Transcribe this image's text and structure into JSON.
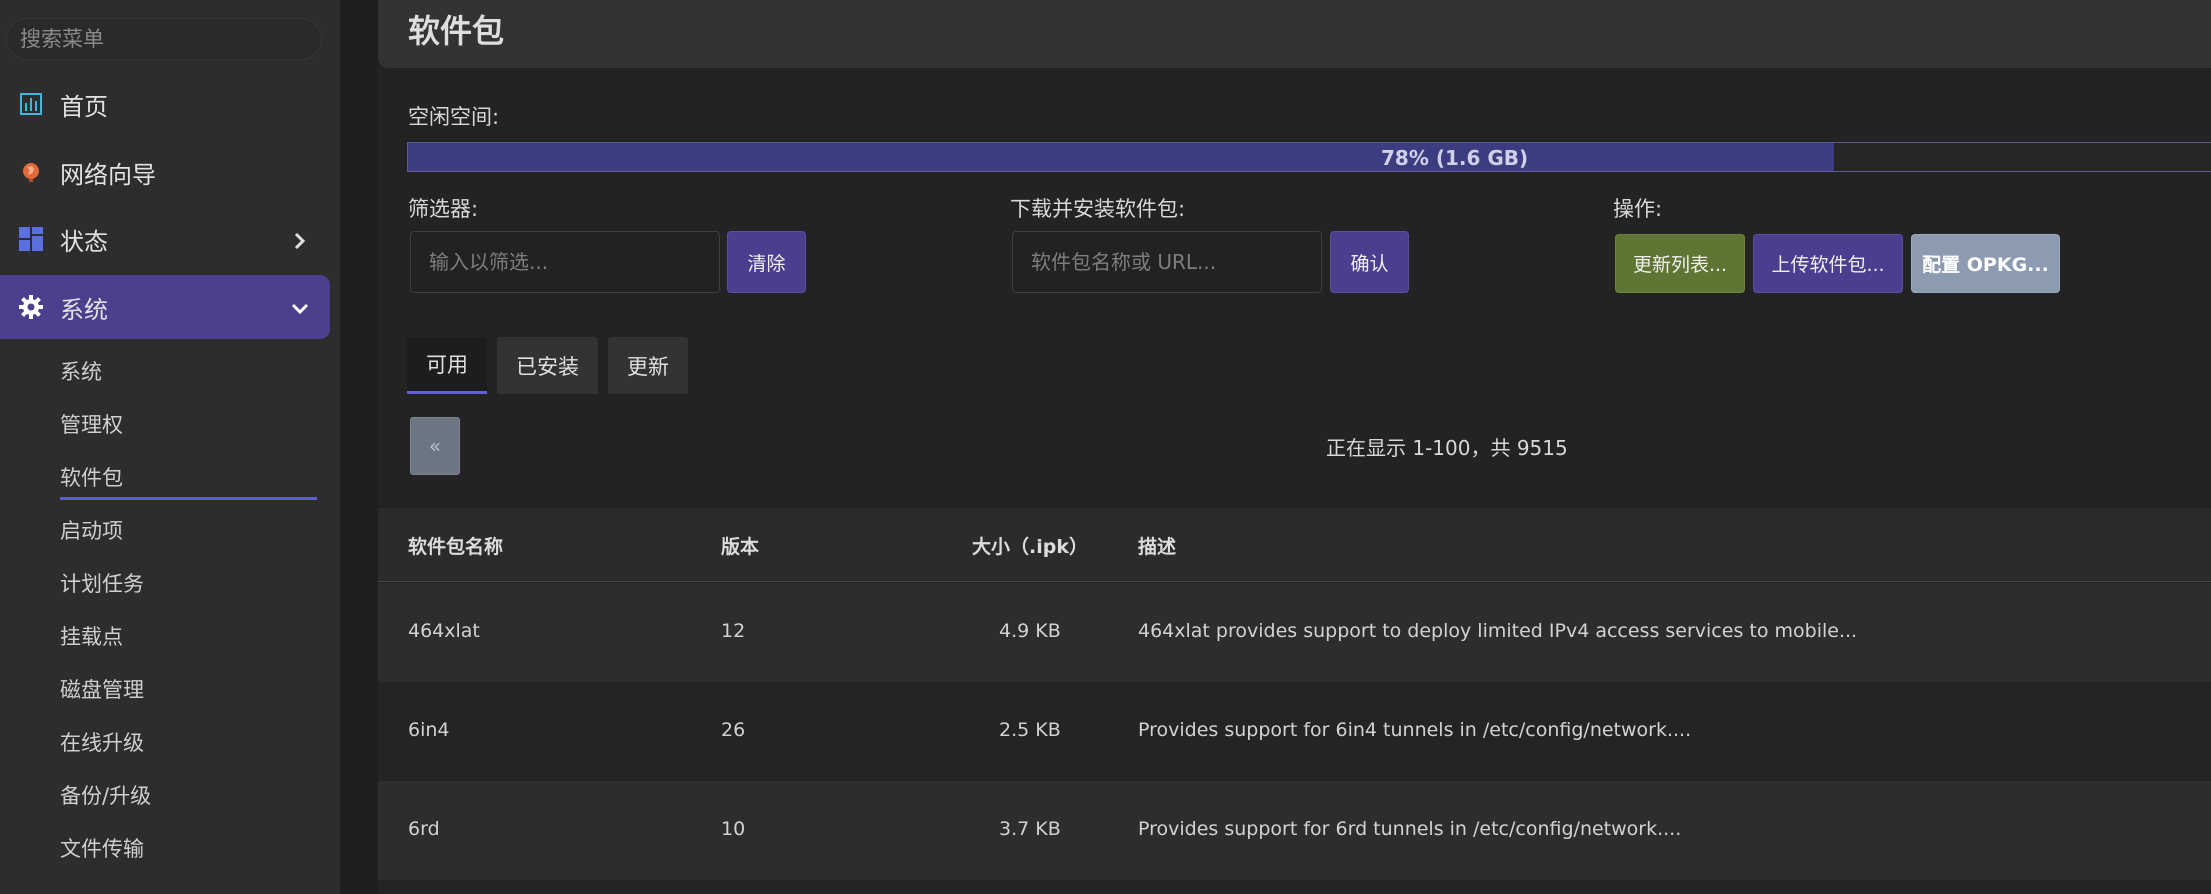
{
  "sidebar": {
    "search_placeholder": "搜索菜单",
    "items": [
      {
        "label": "首页"
      },
      {
        "label": "网络向导"
      },
      {
        "label": "状态"
      },
      {
        "label": "系统"
      }
    ],
    "sub_items": [
      "系统",
      "管理权",
      "软件包",
      "启动项",
      "计划任务",
      "挂载点",
      "磁盘管理",
      "在线升级",
      "备份/升级",
      "文件传输"
    ],
    "active_sub": "软件包",
    "accent_color": "#4d3f8d"
  },
  "header": {
    "title": "软件包"
  },
  "storage": {
    "label": "空闲空间:",
    "percent": 78,
    "text": "78% (1.6 GB)"
  },
  "filter": {
    "label": "筛选器:",
    "placeholder": "输入以筛选...",
    "clear_label": "清除"
  },
  "install": {
    "label": "下载并安装软件包:",
    "placeholder": "软件包名称或 URL...",
    "confirm_label": "确认"
  },
  "actions": {
    "label": "操作:",
    "update_label": "更新列表...",
    "upload_label": "上传软件包...",
    "config_label": "配置 OPKG..."
  },
  "tabs": [
    {
      "label": "可用",
      "active": true
    },
    {
      "label": "已安装",
      "active": false
    },
    {
      "label": "更新",
      "active": false
    }
  ],
  "pager": {
    "prev_label": "«",
    "status": "正在显示 1-100，共 9515"
  },
  "table": {
    "columns": [
      "软件包名称",
      "版本",
      "大小（.ipk）",
      "描述"
    ],
    "rows": [
      {
        "name": "464xlat",
        "version": "12",
        "size": "4.9 KB",
        "desc": "464xlat provides support to deploy limited IPv4 access services to mobile..."
      },
      {
        "name": "6in4",
        "version": "26",
        "size": "2.5 KB",
        "desc": "Provides support for 6in4 tunnels in /etc/config/network...."
      },
      {
        "name": "6rd",
        "version": "10",
        "size": "3.7 KB",
        "desc": "Provides support for 6rd tunnels in /etc/config/network...."
      }
    ]
  }
}
